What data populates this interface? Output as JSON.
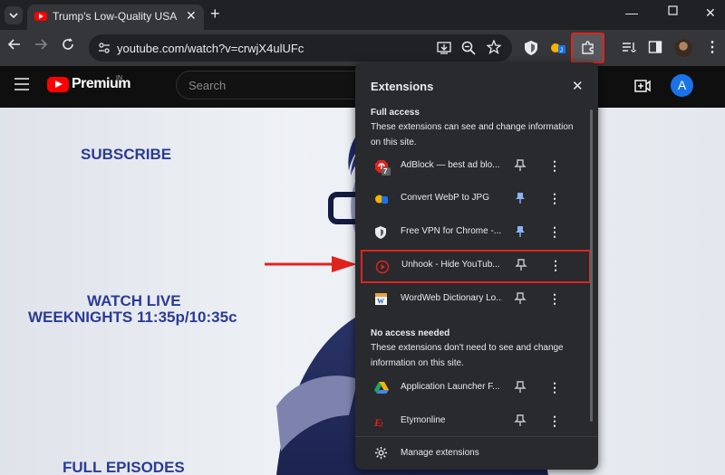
{
  "browser": {
    "tab_title": "Trump's Low-Quality USA Bibles",
    "new_tab_label": "+",
    "url": "youtube.com/watch?v=crwjX4ulUFc"
  },
  "youtube": {
    "logo_text": "Premium",
    "logo_badge": "IN",
    "search_placeholder": "Search",
    "avatar_letter": "A",
    "brand_color": "#ff0000",
    "avatar_color": "#1a73e8"
  },
  "video": {
    "subscribe": "SUBSCRIBE",
    "watch_live": "WATCH LIVE",
    "weeknights": "WEEKNIGHTS 11:35p/10:35c",
    "full_episodes": "FULL EPISODES"
  },
  "extensions_popup": {
    "title": "Extensions",
    "full_access": {
      "heading": "Full access",
      "description": "These extensions can see and change information on this site.",
      "items": [
        {
          "name": "AdBlock — best ad blo...",
          "icon": "adblock-icon",
          "badge": "7",
          "pinned": false
        },
        {
          "name": "Convert WebP to JPG",
          "icon": "convert-webp-icon",
          "pinned": true
        },
        {
          "name": "Free VPN for Chrome -...",
          "icon": "shield-vpn-icon",
          "pinned": true
        },
        {
          "name": "Unhook - Hide YouTub...",
          "icon": "unhook-icon",
          "pinned": false,
          "highlighted": true
        },
        {
          "name": "WordWeb Dictionary Lo...",
          "icon": "wordweb-icon",
          "pinned": false
        }
      ]
    },
    "no_access": {
      "heading": "No access needed",
      "description": "These extensions don't need to see and change information on this site.",
      "items": [
        {
          "name": "Application Launcher F...",
          "icon": "google-drive-icon",
          "pinned": false
        },
        {
          "name": "Etymonline",
          "icon": "etymonline-icon",
          "pinned": false
        }
      ]
    },
    "manage_label": "Manage extensions",
    "highlight_color": "#e0231e",
    "pinned_color": "#8ab4f8"
  }
}
